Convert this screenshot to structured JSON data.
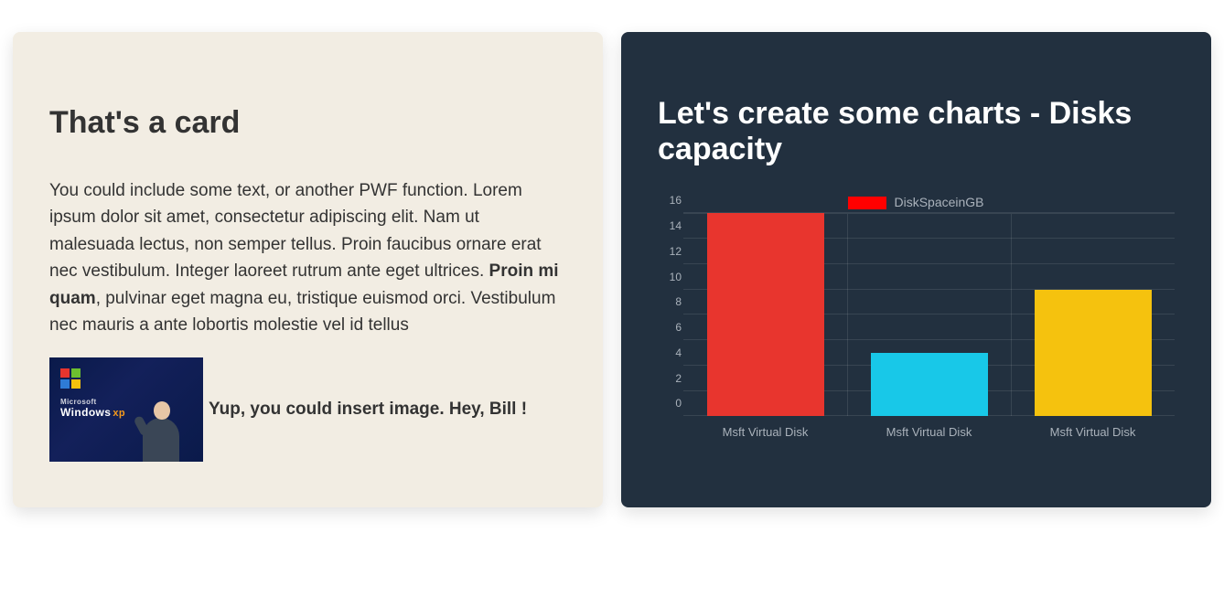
{
  "left_card": {
    "title": "That's a card",
    "para_pre": "You could include some text, or another PWF function. Lorem ipsum dolor sit amet, consectetur adipiscing elit. Nam ut malesuada lectus, non semper tellus. Proin faucibus ornare erat nec vestibulum. Integer laoreet rutrum ante eget ultrices. ",
    "para_bold": "Proin mi quam",
    "para_post": ", pulvinar eget magna eu, tristique euismod orci. Vestibulum nec mauris a ante lobortis molestie vel id tellus",
    "thumb_text_a": "Windows",
    "thumb_text_b": "xp",
    "img_caption": "Yup, you could insert image. Hey, Bill !"
  },
  "right_card": {
    "title": "Let's create some charts - Disks capacity"
  },
  "chart_data": {
    "type": "bar",
    "title": "Let's create some charts - Disks capacity",
    "xlabel": "",
    "ylabel": "",
    "ylim": [
      0,
      16
    ],
    "yticks": [
      0,
      2,
      4,
      6,
      8,
      10,
      12,
      14,
      16
    ],
    "categories": [
      "Msft Virtual Disk",
      "Msft Virtual Disk",
      "Msft Virtual Disk"
    ],
    "legend": "DiskSpaceinGB",
    "series": [
      {
        "name": "DiskSpaceinGB",
        "values": [
          16.5,
          5,
          10
        ],
        "colors": [
          "#e8352e",
          "#18c8e8",
          "#f5c20e"
        ]
      }
    ]
  }
}
